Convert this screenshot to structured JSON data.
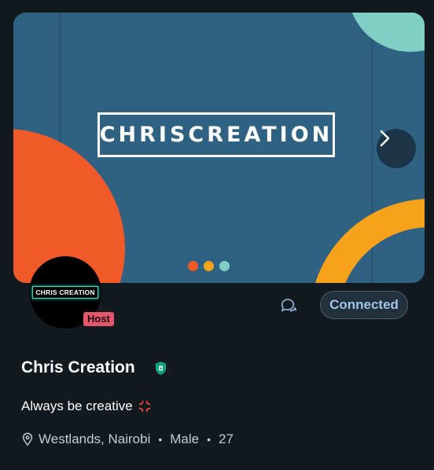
{
  "banner": {
    "logo_text": "CHRISCREATION",
    "background_color": "#2f6282",
    "dot_colors": [
      "#f05a28",
      "#f7a21b",
      "#7fcfc4"
    ]
  },
  "profile": {
    "avatar_logo_text": "CHRIS CREATION",
    "host_badge": "Host",
    "name": "Chris Creation",
    "bio": "Always be creative",
    "location": "Westlands, Nairobi",
    "gender": "Male",
    "age": "27",
    "separator": "•"
  },
  "actions": {
    "connected_label": "Connected"
  },
  "icons": {
    "chat": "chat-bubbles-icon",
    "next": "chevron-right-icon",
    "verified": "verified-shield-icon",
    "anger": "anger-symbol-icon",
    "location": "location-pin-icon"
  }
}
